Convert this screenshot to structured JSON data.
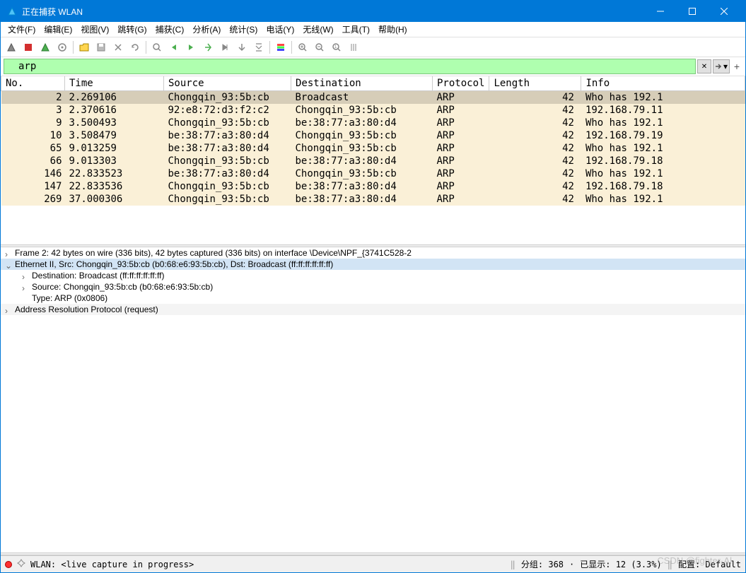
{
  "window": {
    "title": "正在捕获 WLAN"
  },
  "menu": {
    "file": "文件(F)",
    "edit": "编辑(E)",
    "view": "视图(V)",
    "jump": "跳转(G)",
    "capture": "捕获(C)",
    "analyze": "分析(A)",
    "stats": "统计(S)",
    "phone": "电话(Y)",
    "wireless": "无线(W)",
    "tools": "工具(T)",
    "help": "帮助(H)"
  },
  "filter": {
    "value": "arp"
  },
  "columns": {
    "no": "No.",
    "time": "Time",
    "source": "Source",
    "dest": "Destination",
    "protocol": "Protocol",
    "length": "Length",
    "info": "Info"
  },
  "packets": [
    {
      "no": "2",
      "time": "2.269106",
      "src": "Chongqin_93:5b:cb",
      "dst": "Broadcast",
      "proto": "ARP",
      "len": "42",
      "info": "Who has 192.1",
      "selected": true
    },
    {
      "no": "3",
      "time": "2.370616",
      "src": "92:e8:72:d3:f2:c2",
      "dst": "Chongqin_93:5b:cb",
      "proto": "ARP",
      "len": "42",
      "info": "192.168.79.11"
    },
    {
      "no": "9",
      "time": "3.500493",
      "src": "Chongqin_93:5b:cb",
      "dst": "be:38:77:a3:80:d4",
      "proto": "ARP",
      "len": "42",
      "info": "Who has 192.1"
    },
    {
      "no": "10",
      "time": "3.508479",
      "src": "be:38:77:a3:80:d4",
      "dst": "Chongqin_93:5b:cb",
      "proto": "ARP",
      "len": "42",
      "info": "192.168.79.19"
    },
    {
      "no": "65",
      "time": "9.013259",
      "src": "be:38:77:a3:80:d4",
      "dst": "Chongqin_93:5b:cb",
      "proto": "ARP",
      "len": "42",
      "info": "Who has 192.1"
    },
    {
      "no": "66",
      "time": "9.013303",
      "src": "Chongqin_93:5b:cb",
      "dst": "be:38:77:a3:80:d4",
      "proto": "ARP",
      "len": "42",
      "info": "192.168.79.18"
    },
    {
      "no": "146",
      "time": "22.833523",
      "src": "be:38:77:a3:80:d4",
      "dst": "Chongqin_93:5b:cb",
      "proto": "ARP",
      "len": "42",
      "info": "Who has 192.1"
    },
    {
      "no": "147",
      "time": "22.833536",
      "src": "Chongqin_93:5b:cb",
      "dst": "be:38:77:a3:80:d4",
      "proto": "ARP",
      "len": "42",
      "info": "192.168.79.18"
    },
    {
      "no": "269",
      "time": "37.000306",
      "src": "Chongqin_93:5b:cb",
      "dst": "be:38:77:a3:80:d4",
      "proto": "ARP",
      "len": "42",
      "info": "Who has 192.1"
    }
  ],
  "details": {
    "frame": "Frame 2: 42 bytes on wire (336 bits), 42 bytes captured (336 bits) on interface \\Device\\NPF_{3741C528-2",
    "ethernet": "Ethernet II, Src: Chongqin_93:5b:cb (b0:68:e6:93:5b:cb), Dst: Broadcast (ff:ff:ff:ff:ff:ff)",
    "eth_dst": "Destination: Broadcast (ff:ff:ff:ff:ff:ff)",
    "eth_src": "Source: Chongqin_93:5b:cb (b0:68:e6:93:5b:cb)",
    "eth_type": "Type: ARP (0x0806)",
    "arp": "Address Resolution Protocol (request)"
  },
  "status": {
    "capture": "WLAN: <live capture in progress>",
    "packets": "分组: 368",
    "dot": "·",
    "displayed": "已显示: 12 (3.3%)",
    "profile": "配置: Default"
  },
  "watermark": "CSDN @fighter-Al"
}
